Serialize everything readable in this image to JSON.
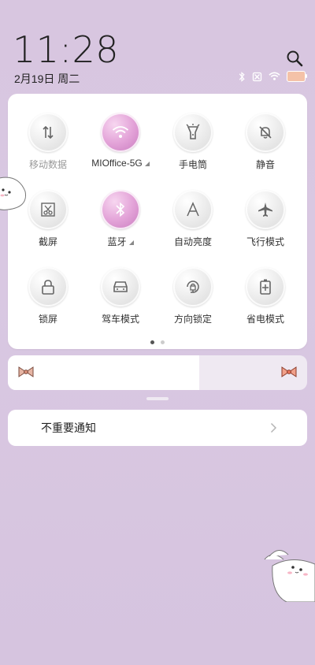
{
  "clock": {
    "time": "11:28",
    "date": "2月19日 周二"
  },
  "status_icons": [
    "bluetooth-icon",
    "sim-off-icon",
    "wifi-icon",
    "battery-icon"
  ],
  "tiles": [
    {
      "id": "mobile-data",
      "label": "移动数据",
      "icon": "arrows-updown-icon",
      "on": false,
      "dim": true
    },
    {
      "id": "wifi",
      "label": "MIOffice-5G",
      "icon": "wifi-icon",
      "on": true,
      "arrow": true
    },
    {
      "id": "flashlight",
      "label": "手电筒",
      "icon": "flashlight-icon",
      "on": false
    },
    {
      "id": "silent",
      "label": "静音",
      "icon": "bell-off-icon",
      "on": false
    },
    {
      "id": "screenshot",
      "label": "截屏",
      "icon": "scissors-icon",
      "on": false
    },
    {
      "id": "bluetooth",
      "label": "蓝牙",
      "icon": "bluetooth-icon",
      "on": true,
      "arrow": true
    },
    {
      "id": "auto-brightness",
      "label": "自动亮度",
      "icon": "letter-a-icon",
      "on": false
    },
    {
      "id": "airplane",
      "label": "飞行模式",
      "icon": "airplane-icon",
      "on": false
    },
    {
      "id": "lock-screen",
      "label": "锁屏",
      "icon": "lock-icon",
      "on": false
    },
    {
      "id": "driving-mode",
      "label": "驾车模式",
      "icon": "car-icon",
      "on": false
    },
    {
      "id": "rotation-lock",
      "label": "方向锁定",
      "icon": "rotation-lock-icon",
      "on": false
    },
    {
      "id": "battery-saver",
      "label": "省电模式",
      "icon": "battery-saver-icon",
      "on": false
    }
  ],
  "brightness": {
    "level": 0.64
  },
  "notification": {
    "label": "不重要通知"
  },
  "page_indicator": {
    "count": 2,
    "active": 1
  },
  "colors": {
    "accent": "#d18bc8",
    "background": "#d8c6e0"
  }
}
